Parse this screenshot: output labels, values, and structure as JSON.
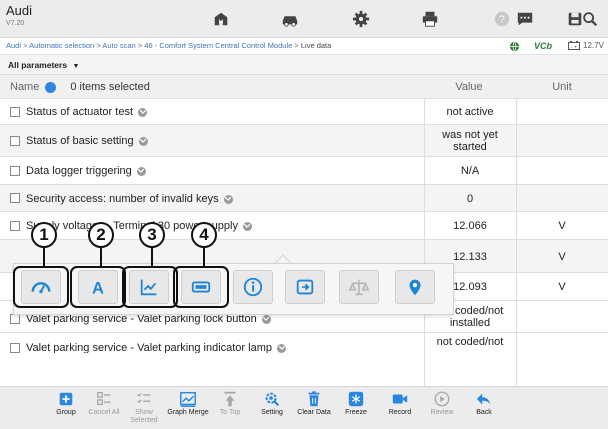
{
  "app": {
    "title": "Audi",
    "version": "V7.20"
  },
  "breadcrumb": {
    "items": [
      "Audi",
      "Automatic selection",
      "Auto scan",
      "46 - Comfort System Central Control Module",
      "Live data"
    ],
    "separator": ">"
  },
  "status": {
    "vci_label": "VCb",
    "voltage": "12.7V"
  },
  "filter": {
    "label": "All parameters",
    "arrow": "▼"
  },
  "table": {
    "headers": {
      "name": "Name",
      "selection": "0 items selected",
      "value": "Value",
      "unit": "Unit"
    },
    "rows": [
      {
        "name": "Status of actuator test",
        "value": "not active",
        "unit": ""
      },
      {
        "name": "Status of basic setting",
        "value": "was not yet started",
        "unit": ""
      },
      {
        "name": "Data logger triggering",
        "value": "N/A",
        "unit": ""
      },
      {
        "name": "Security access: number of invalid keys",
        "value": "0",
        "unit": ""
      },
      {
        "name": "Supply voltages - Terminal 30 power supply",
        "value": "12.066",
        "unit": "V"
      },
      {
        "name": "",
        "value": "12.133",
        "unit": "V"
      },
      {
        "name": "",
        "value": "12.093",
        "unit": "V"
      },
      {
        "name": "Valet parking service - Valet parking lock button",
        "value": "not coded/not installed",
        "unit": ""
      },
      {
        "name": "Valet parking service - Valet parking indicator lamp",
        "value": "not coded/not",
        "unit": ""
      }
    ]
  },
  "popup": {
    "modes": [
      "analog-gauge",
      "text",
      "graph",
      "digital-gauge",
      "info",
      "save",
      "compare",
      "pin"
    ],
    "callouts": [
      "1",
      "2",
      "3",
      "4"
    ]
  },
  "toolbar_icons": [
    "home",
    "vehicle",
    "settings",
    "print",
    "help",
    "save",
    "message",
    "search"
  ],
  "bottom_bar": [
    {
      "label": "Group",
      "enabled": true,
      "icon": "group-icon"
    },
    {
      "label": "Cancel All",
      "enabled": false,
      "icon": "cancel-all-icon"
    },
    {
      "label": "Show Selected",
      "enabled": false,
      "icon": "show-selected-icon"
    },
    {
      "label": "Graph Merge",
      "enabled": true,
      "icon": "graph-merge-icon"
    },
    {
      "label": "To Top",
      "enabled": false,
      "icon": "to-top-icon"
    },
    {
      "label": "Setting",
      "enabled": true,
      "icon": "setting-icon"
    },
    {
      "label": "Clear Data",
      "enabled": true,
      "icon": "clear-data-icon"
    },
    {
      "label": "Freeze",
      "enabled": true,
      "icon": "freeze-icon"
    },
    {
      "label": "Record",
      "enabled": true,
      "icon": "record-icon"
    },
    {
      "label": "Review",
      "enabled": false,
      "icon": "review-icon"
    },
    {
      "label": "Back",
      "enabled": true,
      "icon": "back-icon"
    }
  ],
  "colors": {
    "accent": "#2a86e0",
    "link": "#3f74b5",
    "vci_green": "#2d7d2d"
  }
}
